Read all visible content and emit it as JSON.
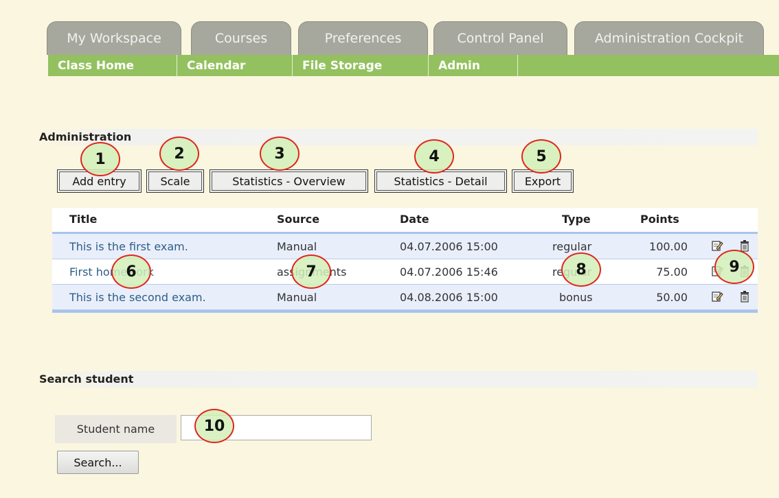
{
  "tabs": [
    "My Workspace",
    "Courses",
    "Preferences",
    "Control Panel",
    "Administration Cockpit"
  ],
  "subnav": [
    "Class Home",
    "Calendar",
    "File Storage",
    "Admin"
  ],
  "administration": {
    "title": "Administration",
    "buttons": {
      "add_entry": "Add entry",
      "scale": "Scale",
      "stats_overview": "Statistics - Overview",
      "stats_detail": "Statistics - Detail",
      "export": "Export"
    }
  },
  "table": {
    "headers": {
      "title": "Title",
      "source": "Source",
      "date": "Date",
      "type": "Type",
      "points": "Points"
    },
    "rows": [
      {
        "title": "This is the first exam.",
        "source": "Manual",
        "date": "04.07.2006 15:00",
        "type": "regular",
        "points": "100.00"
      },
      {
        "title": "First homework",
        "source": "assignments",
        "date": "04.07.2006 15:46",
        "type": "regular",
        "points": "75.00"
      },
      {
        "title": "This is the second exam.",
        "source": "Manual",
        "date": "04.08.2006 15:00",
        "type": "bonus",
        "points": "50.00"
      }
    ]
  },
  "search": {
    "title": "Search student",
    "label": "Student name",
    "value": "",
    "button": "Search..."
  },
  "callouts": [
    "1",
    "2",
    "3",
    "4",
    "5",
    "6",
    "7",
    "8",
    "9",
    "10"
  ],
  "colors": {
    "page_bg": "#fbf6e0",
    "tab_bg": "#a7a89d",
    "subnav_bg": "#94c15f",
    "row_highlight": "#e9eefb",
    "link": "#2d5e86",
    "callout_border": "#e0261c"
  },
  "icons": {
    "edit": "edit-icon",
    "delete": "trash-icon"
  }
}
